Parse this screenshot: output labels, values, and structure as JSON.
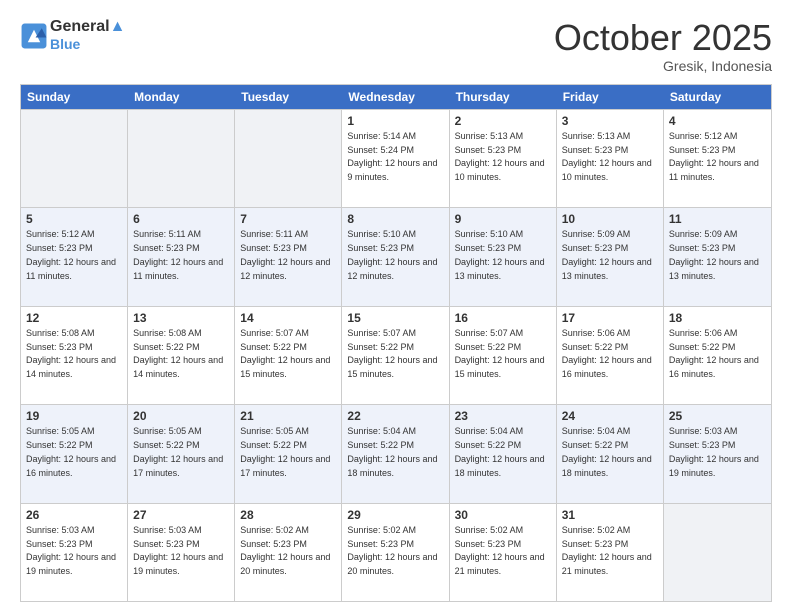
{
  "header": {
    "logo_line1": "General",
    "logo_line2": "Blue",
    "month": "October 2025",
    "location": "Gresik, Indonesia"
  },
  "days_of_week": [
    "Sunday",
    "Monday",
    "Tuesday",
    "Wednesday",
    "Thursday",
    "Friday",
    "Saturday"
  ],
  "weeks": [
    [
      {
        "day": "",
        "empty": true
      },
      {
        "day": "",
        "empty": true
      },
      {
        "day": "",
        "empty": true
      },
      {
        "day": "1",
        "sunrise": "5:14 AM",
        "sunset": "5:24 PM",
        "daylight": "12 hours and 9 minutes."
      },
      {
        "day": "2",
        "sunrise": "5:13 AM",
        "sunset": "5:23 PM",
        "daylight": "12 hours and 10 minutes."
      },
      {
        "day": "3",
        "sunrise": "5:13 AM",
        "sunset": "5:23 PM",
        "daylight": "12 hours and 10 minutes."
      },
      {
        "day": "4",
        "sunrise": "5:12 AM",
        "sunset": "5:23 PM",
        "daylight": "12 hours and 11 minutes."
      }
    ],
    [
      {
        "day": "5",
        "sunrise": "5:12 AM",
        "sunset": "5:23 PM",
        "daylight": "12 hours and 11 minutes."
      },
      {
        "day": "6",
        "sunrise": "5:11 AM",
        "sunset": "5:23 PM",
        "daylight": "12 hours and 11 minutes."
      },
      {
        "day": "7",
        "sunrise": "5:11 AM",
        "sunset": "5:23 PM",
        "daylight": "12 hours and 12 minutes."
      },
      {
        "day": "8",
        "sunrise": "5:10 AM",
        "sunset": "5:23 PM",
        "daylight": "12 hours and 12 minutes."
      },
      {
        "day": "9",
        "sunrise": "5:10 AM",
        "sunset": "5:23 PM",
        "daylight": "12 hours and 13 minutes."
      },
      {
        "day": "10",
        "sunrise": "5:09 AM",
        "sunset": "5:23 PM",
        "daylight": "12 hours and 13 minutes."
      },
      {
        "day": "11",
        "sunrise": "5:09 AM",
        "sunset": "5:23 PM",
        "daylight": "12 hours and 13 minutes."
      }
    ],
    [
      {
        "day": "12",
        "sunrise": "5:08 AM",
        "sunset": "5:23 PM",
        "daylight": "12 hours and 14 minutes."
      },
      {
        "day": "13",
        "sunrise": "5:08 AM",
        "sunset": "5:22 PM",
        "daylight": "12 hours and 14 minutes."
      },
      {
        "day": "14",
        "sunrise": "5:07 AM",
        "sunset": "5:22 PM",
        "daylight": "12 hours and 15 minutes."
      },
      {
        "day": "15",
        "sunrise": "5:07 AM",
        "sunset": "5:22 PM",
        "daylight": "12 hours and 15 minutes."
      },
      {
        "day": "16",
        "sunrise": "5:07 AM",
        "sunset": "5:22 PM",
        "daylight": "12 hours and 15 minutes."
      },
      {
        "day": "17",
        "sunrise": "5:06 AM",
        "sunset": "5:22 PM",
        "daylight": "12 hours and 16 minutes."
      },
      {
        "day": "18",
        "sunrise": "5:06 AM",
        "sunset": "5:22 PM",
        "daylight": "12 hours and 16 minutes."
      }
    ],
    [
      {
        "day": "19",
        "sunrise": "5:05 AM",
        "sunset": "5:22 PM",
        "daylight": "12 hours and 16 minutes."
      },
      {
        "day": "20",
        "sunrise": "5:05 AM",
        "sunset": "5:22 PM",
        "daylight": "12 hours and 17 minutes."
      },
      {
        "day": "21",
        "sunrise": "5:05 AM",
        "sunset": "5:22 PM",
        "daylight": "12 hours and 17 minutes."
      },
      {
        "day": "22",
        "sunrise": "5:04 AM",
        "sunset": "5:22 PM",
        "daylight": "12 hours and 18 minutes."
      },
      {
        "day": "23",
        "sunrise": "5:04 AM",
        "sunset": "5:22 PM",
        "daylight": "12 hours and 18 minutes."
      },
      {
        "day": "24",
        "sunrise": "5:04 AM",
        "sunset": "5:22 PM",
        "daylight": "12 hours and 18 minutes."
      },
      {
        "day": "25",
        "sunrise": "5:03 AM",
        "sunset": "5:23 PM",
        "daylight": "12 hours and 19 minutes."
      }
    ],
    [
      {
        "day": "26",
        "sunrise": "5:03 AM",
        "sunset": "5:23 PM",
        "daylight": "12 hours and 19 minutes."
      },
      {
        "day": "27",
        "sunrise": "5:03 AM",
        "sunset": "5:23 PM",
        "daylight": "12 hours and 19 minutes."
      },
      {
        "day": "28",
        "sunrise": "5:02 AM",
        "sunset": "5:23 PM",
        "daylight": "12 hours and 20 minutes."
      },
      {
        "day": "29",
        "sunrise": "5:02 AM",
        "sunset": "5:23 PM",
        "daylight": "12 hours and 20 minutes."
      },
      {
        "day": "30",
        "sunrise": "5:02 AM",
        "sunset": "5:23 PM",
        "daylight": "12 hours and 21 minutes."
      },
      {
        "day": "31",
        "sunrise": "5:02 AM",
        "sunset": "5:23 PM",
        "daylight": "12 hours and 21 minutes."
      },
      {
        "day": "",
        "empty": true
      }
    ]
  ],
  "labels": {
    "sunrise": "Sunrise:",
    "sunset": "Sunset:",
    "daylight": "Daylight:"
  }
}
